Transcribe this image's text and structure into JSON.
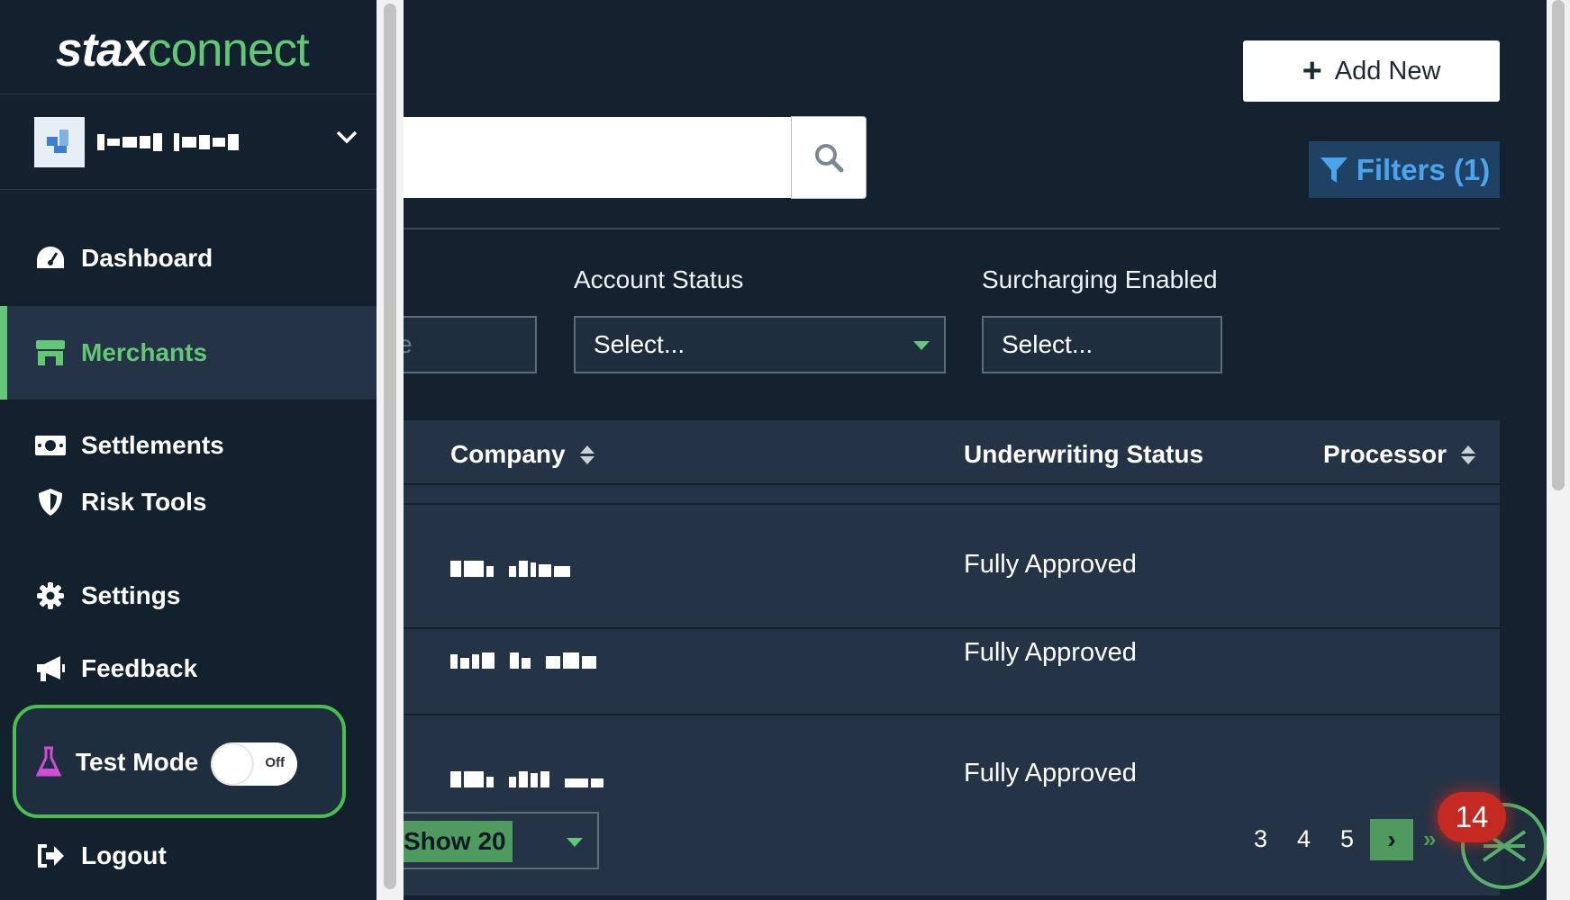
{
  "header": {
    "add_new_label": "Add New",
    "filters_label": "Filters (1)"
  },
  "filters": {
    "partial_placeholder": "e",
    "account_status": {
      "label": "Account Status",
      "placeholder": "Select..."
    },
    "surcharging": {
      "label": "Surcharging Enabled",
      "placeholder": "Select..."
    }
  },
  "table": {
    "columns": [
      "Company",
      "Underwriting Status",
      "Processor"
    ],
    "rows": [
      {
        "status": "Fully Approved"
      },
      {
        "status": "Fully Approved"
      },
      {
        "status": "Fully Approved"
      }
    ]
  },
  "pagination": {
    "page_size_label": "Show 20",
    "pages": [
      "3",
      "4",
      "5"
    ],
    "next": "›",
    "last": "»"
  },
  "notifications": {
    "count": "14"
  },
  "sidebar": {
    "logo_stax": "stax",
    "logo_connect": "connect",
    "items": [
      {
        "label": "Dashboard",
        "icon": "dashboard-gauge-icon"
      },
      {
        "label": "Merchants",
        "icon": "store-icon",
        "active": true
      },
      {
        "label": "Settlements",
        "icon": "money-bill-icon"
      },
      {
        "label": "Risk Tools",
        "icon": "shield-icon"
      },
      {
        "label": "Settings",
        "icon": "gear-icon"
      },
      {
        "label": "Feedback",
        "icon": "megaphone-icon"
      },
      {
        "label": "Logout",
        "icon": "sign-out-icon"
      }
    ],
    "test_mode": {
      "label": "Test Mode",
      "toggle_state": "Off"
    }
  },
  "colors": {
    "background": "#14212f",
    "accent_green": "#62c876",
    "filter_blue": "#4aa4ee",
    "badge_red": "#c42a22"
  }
}
